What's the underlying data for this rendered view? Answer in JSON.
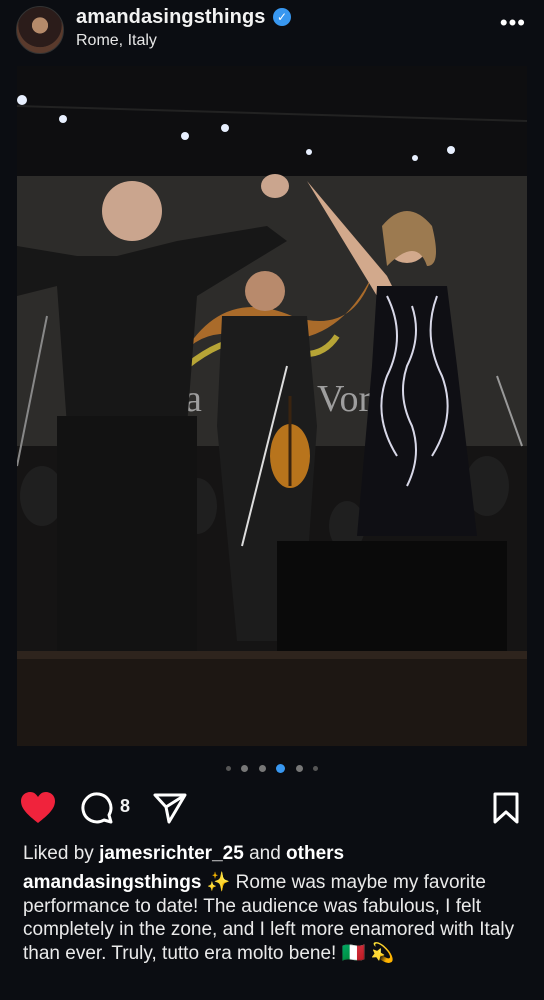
{
  "post": {
    "username": "amandasingsthings",
    "location": "Rome, Italy",
    "more_label": "•••"
  },
  "carousel": {
    "count": 6,
    "active_index": 3
  },
  "actions": {
    "comment_count": "8"
  },
  "likes": {
    "prefix": "Liked by",
    "user": "jamesrichter_25",
    "joiner": "and",
    "suffix": "others"
  },
  "caption": {
    "username": "amandasingsthings",
    "sparkles": "✨",
    "text": "Rome was maybe my favorite performance to date! The audience was fabulous, I felt completely in the zone, and I left more enamored with Italy than ever. Truly, tutto era molto bene!",
    "emoji_flag": "🇮🇹",
    "emoji_star": "💫"
  }
}
